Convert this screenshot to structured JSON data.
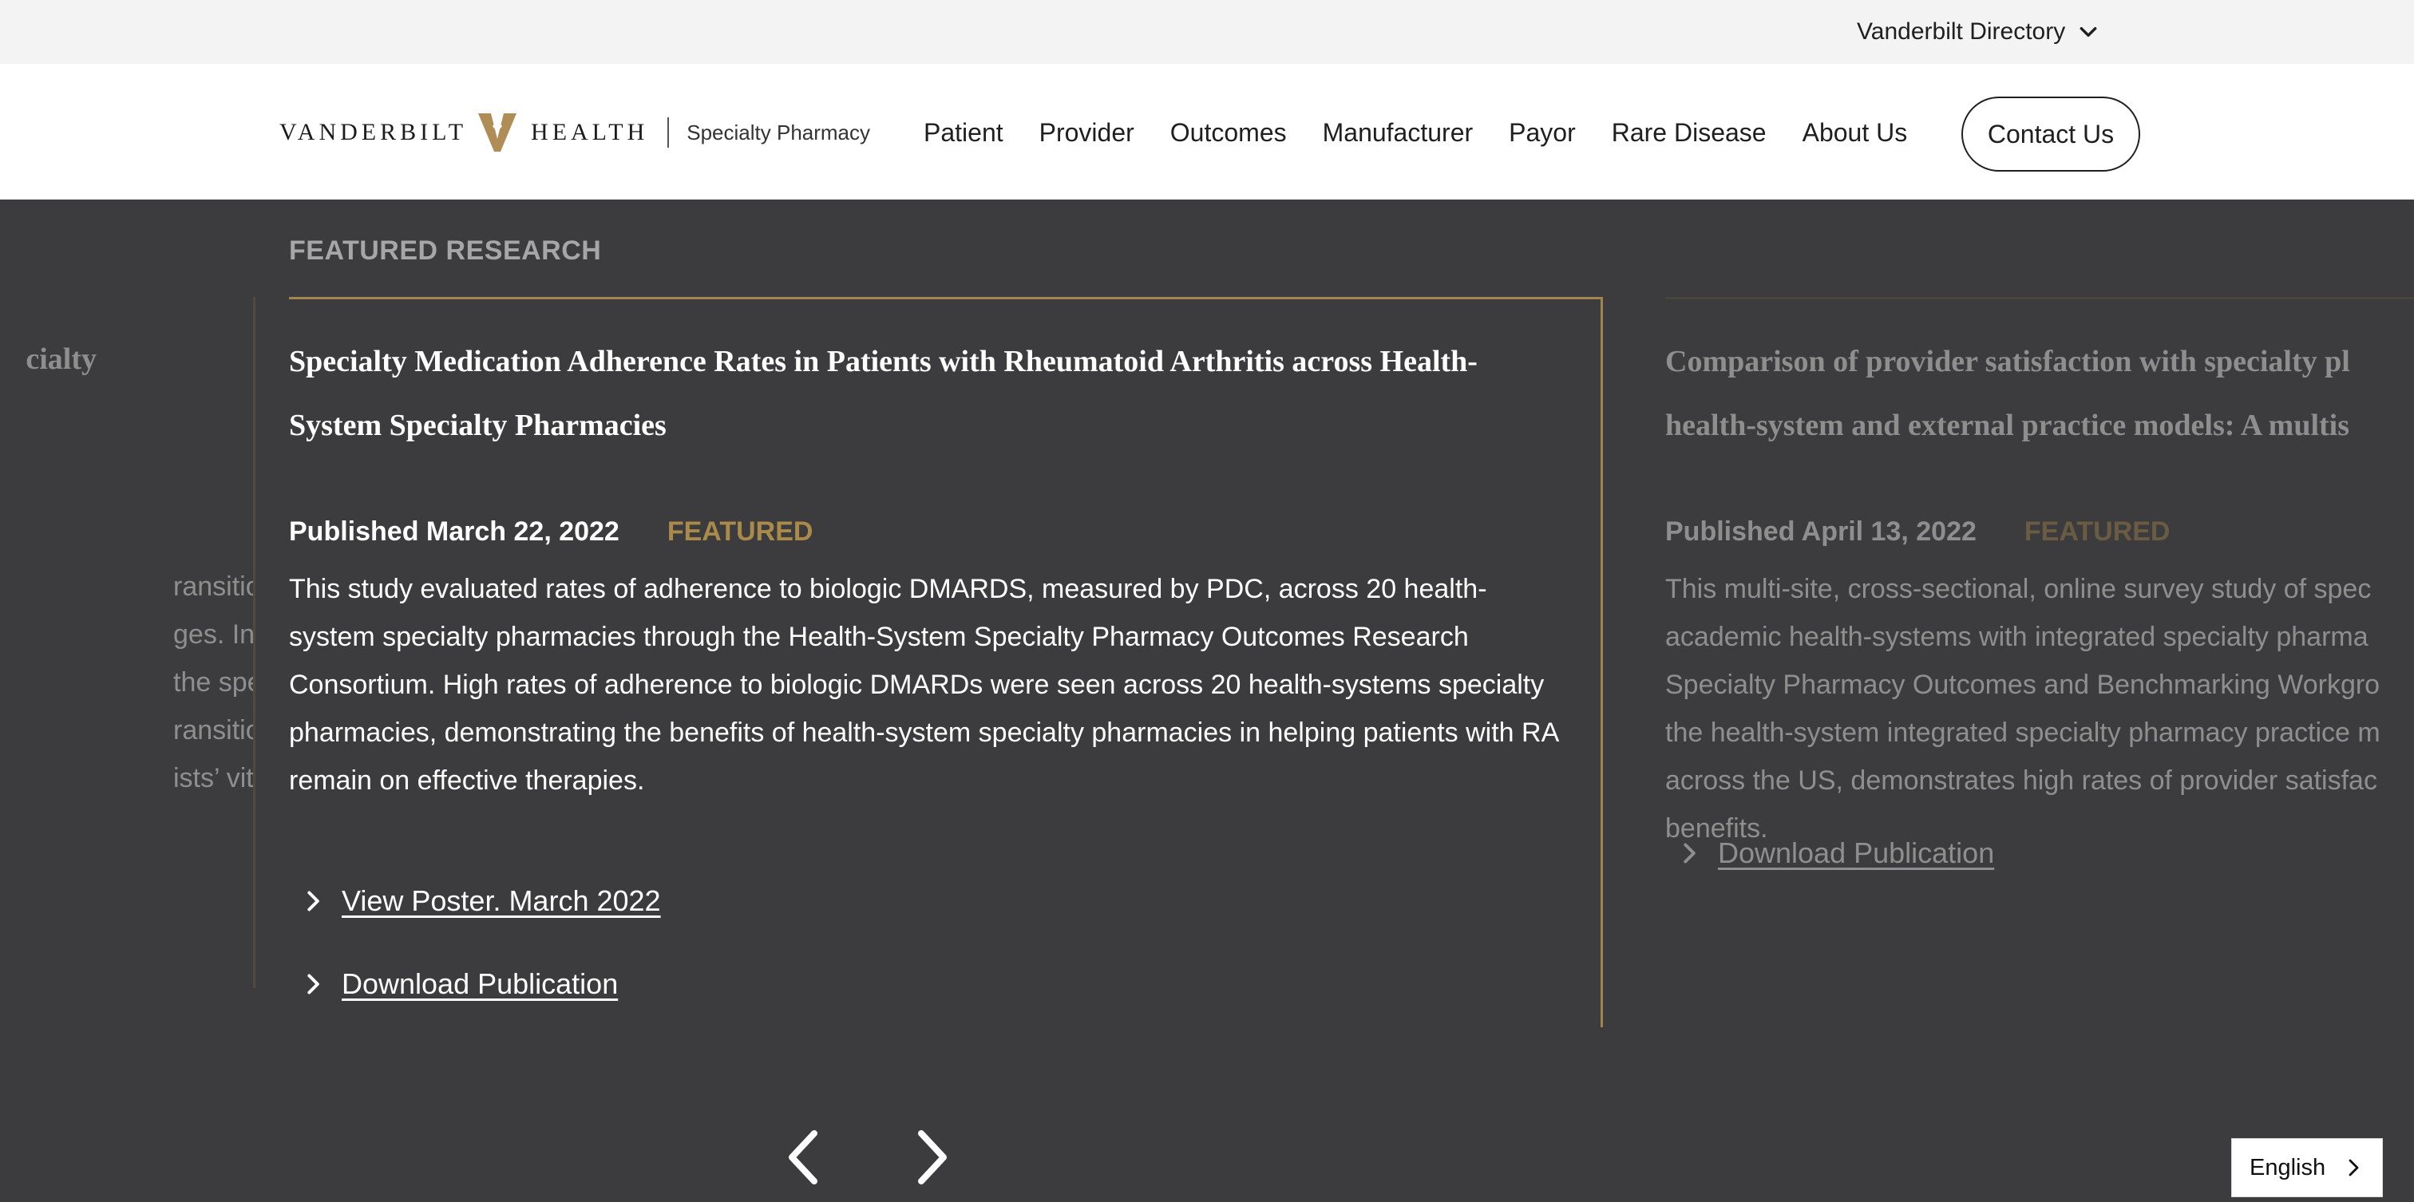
{
  "utility": {
    "directory_label": "Vanderbilt Directory",
    "directory_icon": "chevron-down-icon"
  },
  "header": {
    "logo": {
      "wordmark_left": "VANDERBILT",
      "wordmark_right": "HEALTH",
      "subtitle": "Specialty Pharmacy"
    },
    "nav": [
      {
        "label": "Patient"
      },
      {
        "label": "Provider"
      },
      {
        "label": "Outcomes"
      },
      {
        "label": "Manufacturer"
      },
      {
        "label": "Payor"
      },
      {
        "label": "Rare Disease"
      },
      {
        "label": "About Us"
      }
    ],
    "contact_label": "Contact Us"
  },
  "colors": {
    "accent_gold": "#a5834f",
    "featured_text": "#a98a4a",
    "section_bg": "#3c3c3e"
  },
  "featured": {
    "section_title": "FEATURED RESEARCH",
    "center": {
      "title": "Specialty Medication Adherence Rates in Patients with Rheumatoid Arthritis across Health-System Specialty Pharmacies",
      "published": "Published March 22, 2022",
      "badge": "FEATURED",
      "description": "This study evaluated rates of adherence to biologic DMARDS, measured by PDC, across 20 health-system specialty pharmacies through the Health-System Specialty Pharmacy Outcomes Research Consortium. High rates of adherence to biologic DMARDs were seen across 20 health-systems specialty pharmacies, demonstrating the benefits of health-system specialty pharmacies in helping patients with RA remain on effective therapies.",
      "links": [
        {
          "label": "View Poster. March 2022"
        },
        {
          "label": "Download Publication"
        }
      ]
    },
    "left": {
      "title_fragment": "cialty",
      "desc_lines": [
        "ransitions in",
        "ges. In this",
        "the specialty",
        "ransition provide",
        "ists’ vital role in"
      ]
    },
    "right": {
      "title_lines": [
        "Comparison of provider satisfaction with specialty pl",
        "health-system and external practice models: A multis"
      ],
      "published": "Published April 13, 2022",
      "badge": "FEATURED",
      "desc_lines": [
        "This multi-site, cross-sectional, online survey study of spec",
        "academic health-systems with integrated specialty pharma",
        "Specialty Pharmacy Outcomes and Benchmarking Workgro",
        "the health-system integrated specialty pharmacy practice m",
        "across the US, demonstrates high rates of provider satisfac",
        "benefits."
      ],
      "links": [
        {
          "label": "Download Publication"
        }
      ]
    }
  },
  "carousel": {
    "prev_icon": "chevron-left-icon",
    "next_icon": "chevron-right-icon"
  },
  "language": {
    "selected": "English",
    "icon": "chevron-right-icon"
  }
}
